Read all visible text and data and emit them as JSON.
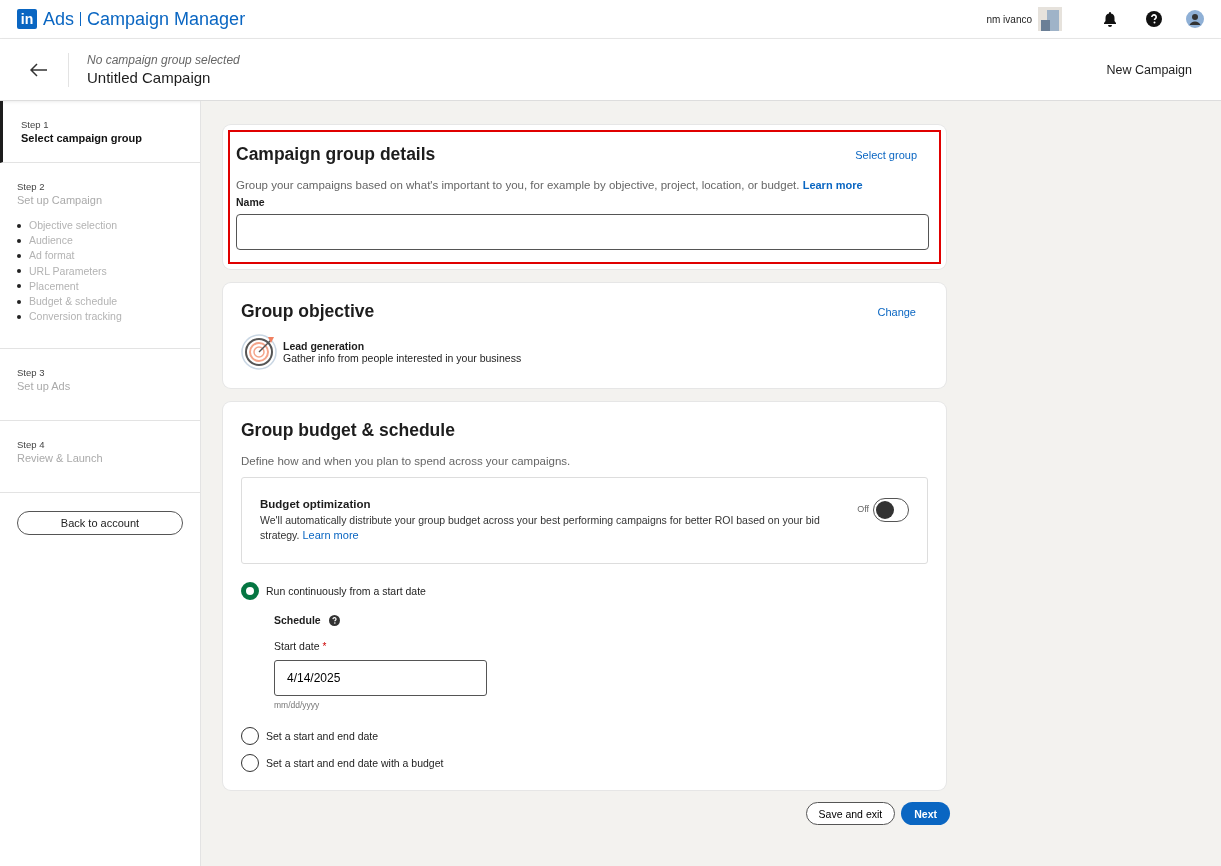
{
  "brand": {
    "logo": "in",
    "product": "Ads",
    "app": "Campaign Manager"
  },
  "account": {
    "name": "nm ivanco"
  },
  "subheader": {
    "group_status": "No campaign group selected",
    "campaign_name": "Untitled Campaign",
    "mode": "New Campaign"
  },
  "steps": [
    {
      "step": "Step 1",
      "title": "Select campaign group",
      "selected": true
    },
    {
      "step": "Step 2",
      "title": "Set up Campaign",
      "selected": false,
      "items": [
        "Objective selection",
        "Audience",
        "Ad format",
        "URL Parameters",
        "Placement",
        "Budget & schedule",
        "Conversion tracking"
      ]
    },
    {
      "step": "Step 3",
      "title": "Set up Ads",
      "selected": false
    },
    {
      "step": "Step 4",
      "title": "Review & Launch",
      "selected": false
    }
  ],
  "back_button": "Back to account",
  "group_details": {
    "title": "Campaign group details",
    "highlighted": true,
    "action": "Select group",
    "description": "Group your campaigns based on what's important to you, for example by objective, project, location, or budget.",
    "learn_more": "Learn more",
    "name_label": "Name"
  },
  "objective": {
    "title": "Group objective",
    "action": "Change",
    "name": "Lead generation",
    "description": "Gather info from people interested in your business"
  },
  "budget": {
    "title": "Group budget & schedule",
    "description": "Define how and when you plan to spend across your campaigns.",
    "optimization": {
      "title": "Budget optimization",
      "text": "We'll automatically distribute your group budget across your best performing campaigns for better ROI based on your bid strategy.",
      "learn_more": "Learn more",
      "toggle_label": "Off",
      "on": false
    },
    "options": [
      {
        "label": "Run continuously from a start date",
        "selected": true
      },
      {
        "label": "Set a start and end date",
        "selected": false
      },
      {
        "label": "Set a start and end date with a budget",
        "selected": false
      }
    ],
    "schedule": {
      "title": "Schedule",
      "start_label": "Start date",
      "required_mark": "*",
      "value": "4/14/2025",
      "hint": "mm/dd/yyyy"
    }
  },
  "footer": {
    "secondary": "Save and exit",
    "primary": "Next"
  }
}
